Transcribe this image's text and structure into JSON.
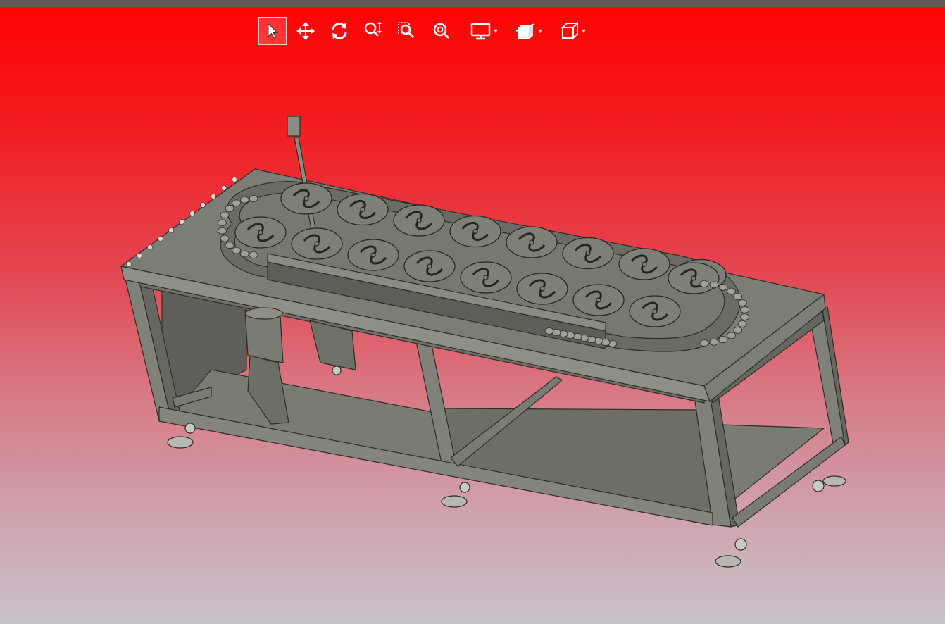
{
  "toolbar": {
    "tools": [
      {
        "name": "select-tool",
        "icon": "cursor-icon",
        "active": true
      },
      {
        "name": "pan-tool",
        "icon": "move-arrows-icon",
        "active": false
      },
      {
        "name": "rotate-tool",
        "icon": "rotate-icon",
        "active": false
      },
      {
        "name": "zoom-tool",
        "icon": "zoom-in-out-icon",
        "active": false
      },
      {
        "name": "zoom-window-tool",
        "icon": "zoom-window-icon",
        "active": false
      },
      {
        "name": "zoom-fit-tool",
        "icon": "zoom-fit-icon",
        "active": false
      },
      {
        "name": "display-mode-dropdown",
        "icon": "monitor-icon",
        "active": false
      },
      {
        "name": "section-view-dropdown",
        "icon": "section-box-icon",
        "active": false
      },
      {
        "name": "standard-views-dropdown",
        "icon": "cube-icon",
        "active": false
      }
    ]
  },
  "colors": {
    "gradient_top": "#ff0404",
    "gradient_bottom": "#c8c2cb",
    "model_fill": "#74756d",
    "model_edge": "#2c2d28",
    "toolbar_icon": "#ffffff"
  }
}
